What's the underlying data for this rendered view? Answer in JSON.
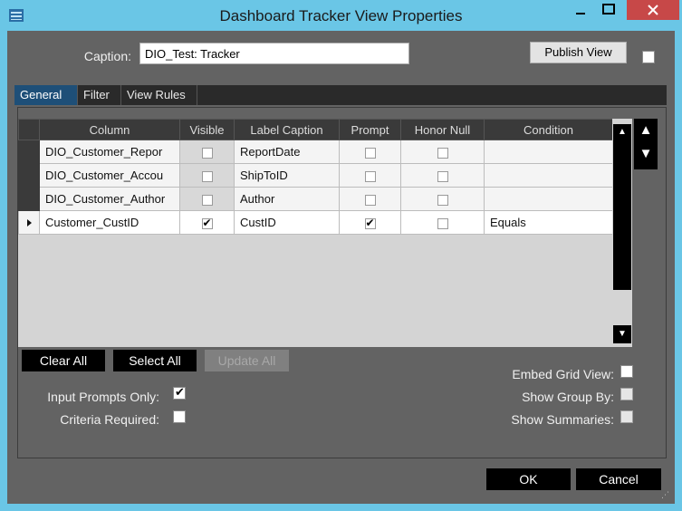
{
  "window": {
    "title": "Dashboard Tracker View Properties"
  },
  "caption": {
    "label": "Caption:",
    "value": "DIO_Test: Tracker"
  },
  "publish": {
    "label": "Publish View",
    "checked": false
  },
  "tabs": [
    {
      "label": "General",
      "active": true
    },
    {
      "label": "Filter",
      "active": false
    },
    {
      "label": "View Rules",
      "active": false
    }
  ],
  "grid": {
    "headers": [
      "Column",
      "Visible",
      "Label Caption",
      "Prompt",
      "Honor Null",
      "Condition"
    ],
    "rows": [
      {
        "column": "DIO_Customer_Repor",
        "visible": false,
        "label": "ReportDate",
        "prompt": false,
        "honor_null": false,
        "condition": "",
        "current": false
      },
      {
        "column": "DIO_Customer_Accou",
        "visible": false,
        "label": "ShipToID",
        "prompt": false,
        "honor_null": false,
        "condition": "",
        "current": false
      },
      {
        "column": "DIO_Customer_Author",
        "visible": false,
        "label": "Author",
        "prompt": false,
        "honor_null": false,
        "condition": "",
        "current": false
      },
      {
        "column": "Customer_CustID",
        "visible": true,
        "label": "CustID",
        "prompt": true,
        "honor_null": false,
        "condition": "Equals",
        "current": true
      }
    ]
  },
  "buttons": {
    "clear_all": "Clear All",
    "select_all": "Select All",
    "update_all": "Update All",
    "ok": "OK",
    "cancel": "Cancel"
  },
  "options": {
    "input_prompts_only": {
      "label": "Input Prompts Only:",
      "checked": true
    },
    "criteria_required": {
      "label": "Criteria Required:",
      "checked": false
    },
    "embed_grid_view": {
      "label": "Embed Grid View:",
      "checked": false
    },
    "show_group_by": {
      "label": "Show Group By:",
      "checked": false
    },
    "show_summaries": {
      "label": "Show Summaries:",
      "checked": false
    }
  }
}
